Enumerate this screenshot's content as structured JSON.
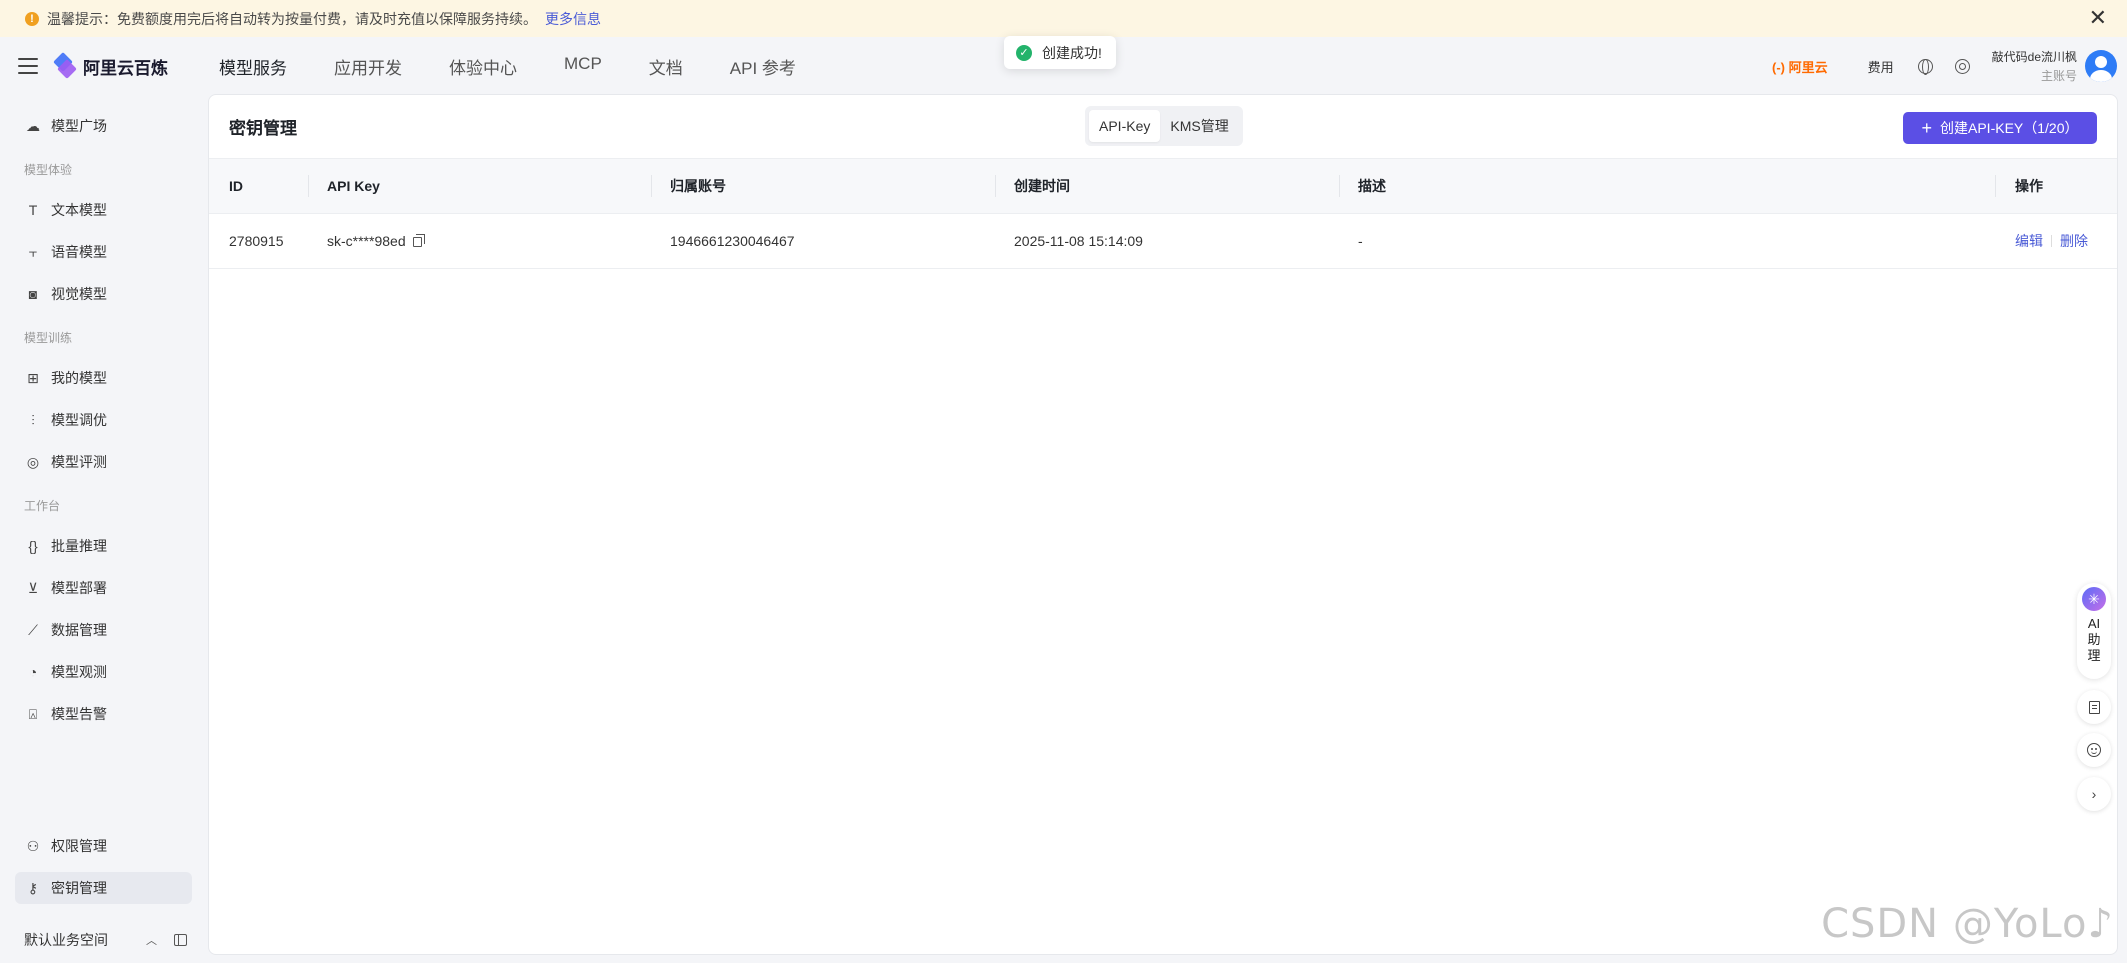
{
  "notice": {
    "text": "温馨提示：免费额度用完后将自动转为按量付费，请及时充值以保障服务持续。",
    "more_link": "更多信息",
    "warn_glyph": "!",
    "close_glyph": "✕"
  },
  "header": {
    "logo_text": "阿里云百炼",
    "tabs": [
      "模型服务",
      "应用开发",
      "体验中心",
      "MCP",
      "文档",
      "API 参考"
    ],
    "active_tab": "模型服务",
    "aliyun_label": "(-) 阿里云",
    "fee_label": "费用",
    "user_name": "敲代码de流川枫",
    "user_role": "主账号"
  },
  "toast": {
    "text": "创建成功!",
    "icon": "check-circle-icon"
  },
  "sidebar": {
    "items": [
      {
        "label": "模型广场",
        "icon": "cloud-icon"
      },
      {
        "label": "文本模型",
        "icon": "text-icon"
      },
      {
        "label": "语音模型",
        "icon": "voice-icon"
      },
      {
        "label": "视觉模型",
        "icon": "camera-icon"
      },
      {
        "label": "我的模型",
        "icon": "grid-icon"
      },
      {
        "label": "模型调优",
        "icon": "sliders-icon"
      },
      {
        "label": "模型评测",
        "icon": "compass-icon"
      },
      {
        "label": "批量推理",
        "icon": "brackets-icon"
      },
      {
        "label": "模型部署",
        "icon": "download-box-icon"
      },
      {
        "label": "数据管理",
        "icon": "chart-icon"
      },
      {
        "label": "模型观测",
        "icon": "pie-icon"
      },
      {
        "label": "模型告警",
        "icon": "alarm-icon"
      },
      {
        "label": "权限管理",
        "icon": "user-icon"
      },
      {
        "label": "密钥管理",
        "icon": "key-icon"
      }
    ],
    "groups": [
      "模型体验",
      "模型训练",
      "工作台"
    ],
    "active_item": "密钥管理",
    "workspace_label": "默认业务空间"
  },
  "main": {
    "title": "密钥管理",
    "segments": [
      "API-Key",
      "KMS管理"
    ],
    "active_segment": "API-Key",
    "create_button": "创建API-KEY（1/20）",
    "table": {
      "columns": [
        "ID",
        "API Key",
        "归属账号",
        "创建时间",
        "描述",
        "操作"
      ],
      "rows": [
        {
          "id": "2780915",
          "api_key": "sk-c****98ed",
          "account": "1946661230046467",
          "created": "2025-11-08 15:14:09",
          "desc": "-",
          "edit": "编辑",
          "delete": "删除"
        }
      ]
    }
  },
  "floating": {
    "ai_label": "AI助理",
    "chevron": "›"
  },
  "watermark": "CSDN @YoLo♪",
  "colors": {
    "accent": "#5b4fe5",
    "link": "#4a5bd6",
    "brand_orange": "#ff6a00",
    "success": "#23b36b",
    "notice_bg": "#fdf6e3"
  }
}
